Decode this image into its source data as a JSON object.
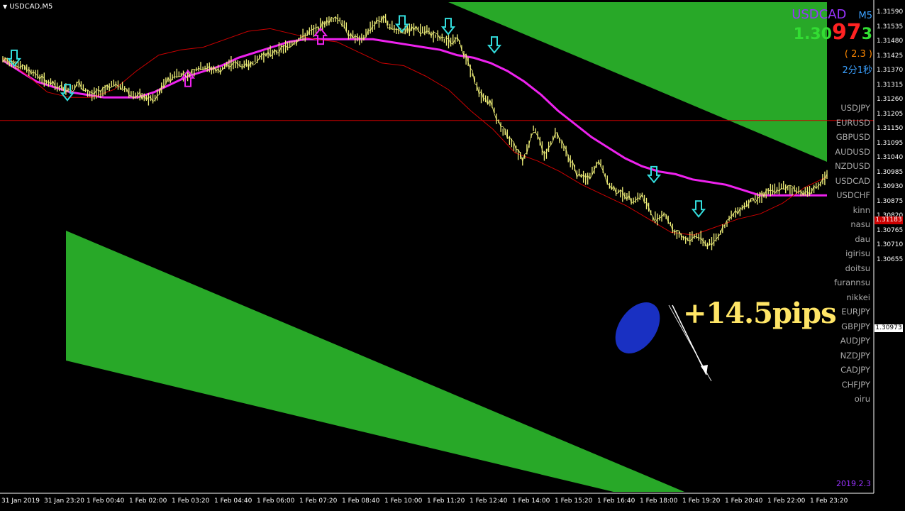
{
  "window": {
    "title": "USDCAD,M5",
    "menu_icon": "triangle-down-icon"
  },
  "quote": {
    "symbol": "USDCAD",
    "timeframe": "M5",
    "bid_prefix": "1.30",
    "bid_big": "97",
    "bid_suffix": "3",
    "spread": "( 2.3 )",
    "countdown": "2分1秒",
    "colors": {
      "symbol": "#9933ff",
      "timeframe": "#3aa0ff",
      "prefix": "#33dd33",
      "big": "#ff2222",
      "suffix": "#33dd33",
      "spread": "#ff8800",
      "countdown": "#3aa0ff"
    }
  },
  "pair_list": [
    "USDJPY",
    "EURUSD",
    "GBPUSD",
    "AUDUSD",
    "NZDUSD",
    "USDCAD",
    "USDCHF",
    "kinn",
    "nasu",
    "dau",
    "igirisu",
    "doitsu",
    "furannsu",
    "nikkei",
    "EURJPY",
    "GBPJPY",
    "AUDJPY",
    "NZDJPY",
    "CADJPY",
    "CHFJPY",
    "oiru"
  ],
  "annotation": {
    "text": "+14.5pips",
    "color": "#ffe566"
  },
  "date_stamp": "2019.2.3",
  "price_axis": {
    "ticks": [
      "1.31590",
      "1.31535",
      "1.31480",
      "1.31425",
      "1.31370",
      "1.31315",
      "1.31260",
      "1.31205",
      "1.31150",
      "1.31095",
      "1.31040",
      "1.30985",
      "1.30930",
      "1.30875",
      "1.30820",
      "1.30765",
      "1.30710",
      "1.30655"
    ],
    "hline_label": "1.31183",
    "current_label": "1.30973"
  },
  "time_axis": [
    "31 Jan 2019",
    "31 Jan 23:20",
    "1 Feb 00:40",
    "1 Feb 02:00",
    "1 Feb 03:20",
    "1 Feb 04:40",
    "1 Feb 06:00",
    "1 Feb 07:20",
    "1 Feb 08:40",
    "1 Feb 10:00",
    "1 Feb 11:20",
    "1 Feb 12:40",
    "1 Feb 14:00",
    "1 Feb 15:20",
    "1 Feb 16:40",
    "1 Feb 18:00",
    "1 Feb 19:20",
    "1 Feb 20:40",
    "1 Feb 22:00",
    "1 Feb 23:20"
  ],
  "chart_data": {
    "type": "line",
    "colors": {
      "price": "#f2f27a",
      "slow_ma": "#ee22ee",
      "fast_ma": "#cc0000",
      "channel": "#28a828",
      "hline": "#cc0000"
    },
    "horizontal_line": 1.31183,
    "price_path": [
      1.3141,
      1.314,
      1.3138,
      1.3136,
      1.3133,
      1.3131,
      1.313,
      1.3132,
      1.3128,
      1.3129,
      1.3132,
      1.3131,
      1.3128,
      1.3127,
      1.3126,
      1.3133,
      1.3136,
      1.3135,
      1.3138,
      1.3138,
      1.3137,
      1.314,
      1.3139,
      1.314,
      1.3143,
      1.3144,
      1.3146,
      1.3148,
      1.3151,
      1.3153,
      1.3156,
      1.3157,
      1.3151,
      1.3148,
      1.3154,
      1.3157,
      1.3153,
      1.3152,
      1.3153,
      1.3152,
      1.315,
      1.3148,
      1.3149,
      1.3139,
      1.3128,
      1.3125,
      1.3115,
      1.311,
      1.3103,
      1.3116,
      1.3105,
      1.3114,
      1.3106,
      1.3098,
      1.3096,
      1.3103,
      1.3093,
      1.3091,
      1.3088,
      1.309,
      1.3081,
      1.3083,
      1.3076,
      1.3073,
      1.3075,
      1.3071,
      1.3075,
      1.3081,
      1.3085,
      1.3088,
      1.309,
      1.3092,
      1.3093,
      1.3092,
      1.3091,
      1.3093,
      1.3097
    ],
    "slow_ma_path": [
      1.3141,
      1.3137,
      1.3133,
      1.3131,
      1.3129,
      1.3128,
      1.3127,
      1.3127,
      1.3127,
      1.3129,
      1.3132,
      1.3135,
      1.3137,
      1.3139,
      1.3142,
      1.3144,
      1.3146,
      1.3148,
      1.3149,
      1.3149,
      1.3149,
      1.3149,
      1.3149,
      1.3148,
      1.3147,
      1.3146,
      1.3145,
      1.3143,
      1.3142,
      1.314,
      1.3137,
      1.3133,
      1.3128,
      1.3122,
      1.3117,
      1.3112,
      1.3108,
      1.3104,
      1.3101,
      1.3099,
      1.3098,
      1.3096,
      1.3095,
      1.3094,
      1.3092,
      1.309,
      1.309,
      1.309,
      1.309,
      1.309
    ],
    "fast_ma_path": [
      1.3142,
      1.3136,
      1.3129,
      1.3127,
      1.3127,
      1.313,
      1.3137,
      1.3143,
      1.3145,
      1.3146,
      1.3149,
      1.3152,
      1.3153,
      1.3151,
      1.3149,
      1.3148,
      1.3144,
      1.314,
      1.3139,
      1.3135,
      1.313,
      1.3122,
      1.3115,
      1.3106,
      1.3103,
      1.3099,
      1.3094,
      1.309,
      1.3086,
      1.3081,
      1.3076,
      1.3075,
      1.3078,
      1.3081,
      1.3083,
      1.3087,
      1.3093,
      1.3097
    ],
    "signals": [
      {
        "dir": "down",
        "price": 1.314,
        "color": "#33dddd"
      },
      {
        "dir": "down",
        "price": 1.3127,
        "color": "#33dddd"
      },
      {
        "dir": "up",
        "price": 1.3136,
        "color": "#ee22ee"
      },
      {
        "dir": "up",
        "price": 1.3152,
        "color": "#ee22ee"
      },
      {
        "dir": "down",
        "price": 1.3153,
        "color": "#33dddd"
      },
      {
        "dir": "down",
        "price": 1.3152,
        "color": "#33dddd"
      },
      {
        "dir": "down",
        "price": 1.3145,
        "color": "#33dddd"
      },
      {
        "dir": "down",
        "price": 1.3096,
        "color": "#33dddd"
      },
      {
        "dir": "down",
        "price": 1.3083,
        "color": "#33dddd"
      }
    ]
  }
}
